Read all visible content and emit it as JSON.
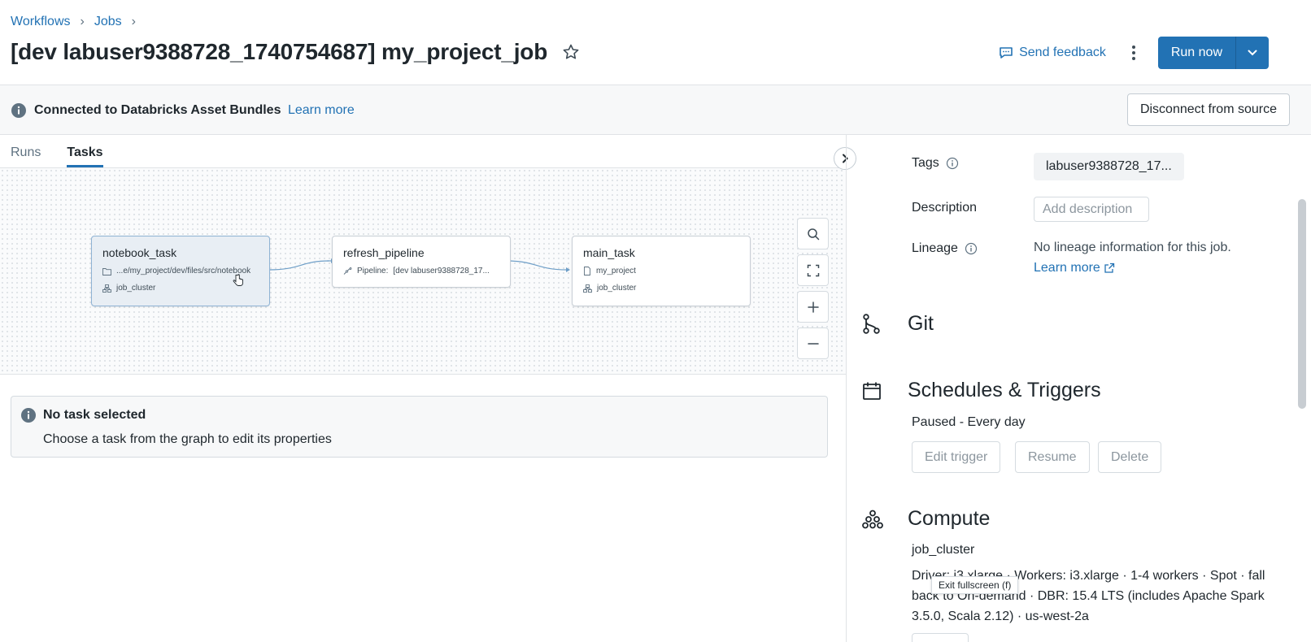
{
  "breadcrumb": [
    {
      "label": "Workflows"
    },
    {
      "label": "Jobs"
    }
  ],
  "page_title": "[dev labuser9388728_1740754687] my_project_job",
  "header": {
    "feedback_label": "Send feedback",
    "run_now_label": "Run now"
  },
  "banner": {
    "text": "Connected to Databricks Asset Bundles",
    "link": "Learn more",
    "disconnect_label": "Disconnect from source"
  },
  "tabs": [
    {
      "label": "Runs",
      "active": false
    },
    {
      "label": "Tasks",
      "active": true
    }
  ],
  "graph": {
    "nodes": [
      {
        "title": "notebook_task",
        "row1": "...e/my_project/dev/files/src/notebook",
        "row2": "job_cluster"
      },
      {
        "title": "refresh_pipeline",
        "row1_label": "Pipeline:",
        "row1": "[dev labuser9388728_17..."
      },
      {
        "title": "main_task",
        "row1": "my_project",
        "row2": "job_cluster"
      }
    ]
  },
  "no_task": {
    "title": "No task selected",
    "description": "Choose a task from the graph to edit its properties"
  },
  "details": {
    "tags_label": "Tags",
    "tag_value": "labuser9388728_17...",
    "description_label": "Description",
    "description_placeholder": "Add description",
    "lineage_label": "Lineage",
    "lineage_text": "No lineage information for this job.",
    "lineage_link": "Learn more"
  },
  "git": {
    "title": "Git"
  },
  "schedules": {
    "title": "Schedules & Triggers",
    "status": "Paused - Every day",
    "edit_label": "Edit trigger",
    "resume_label": "Resume",
    "delete_label": "Delete"
  },
  "compute": {
    "title": "Compute",
    "cluster_name": "job_cluster",
    "description": "Driver: i3.xlarge · Workers: i3.xlarge · 1-4 workers · Spot · fall back to On-demand · DBR: 15.4 LTS (includes Apache Spark 3.5.0, Scala 2.12) · us-west-2a"
  },
  "tooltip": "Exit fullscreen (f)",
  "colors": {
    "accent": "#2272b4",
    "text": "#1f272d",
    "muted": "#5f7281",
    "border": "#d5dbe0"
  }
}
